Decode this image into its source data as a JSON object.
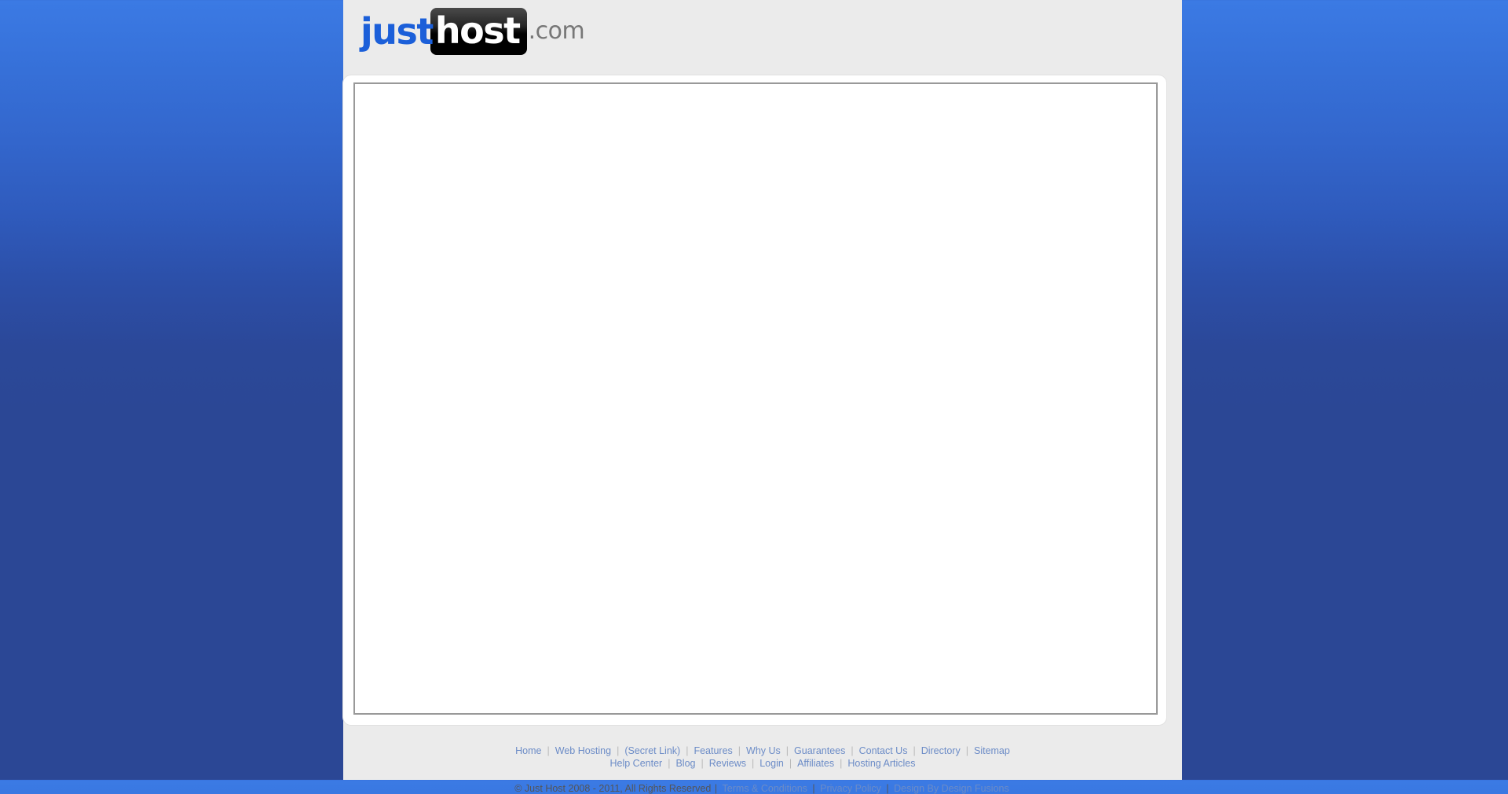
{
  "site": {
    "background_top_color": "#3b7ae4",
    "background_bottom_color": "#2b4795",
    "container_color": "#ebebeb",
    "link_color": "#6c8cc7",
    "panel_border_color": "#999999"
  },
  "header": {
    "logo": {
      "part_just": "just",
      "part_host": "host",
      "part_com": ".com",
      "just_color": "#1b5fd9",
      "host_bg_color": "#000000",
      "com_color": "#777777"
    }
  },
  "main": {
    "content": ""
  },
  "footer": {
    "links_row_1": [
      {
        "label": "Home"
      },
      {
        "label": "Web Hosting"
      },
      {
        "label": "(Secret Link)"
      },
      {
        "label": "Features"
      },
      {
        "label": "Why Us"
      },
      {
        "label": "Guarantees"
      },
      {
        "label": "Contact Us"
      },
      {
        "label": "Directory"
      },
      {
        "label": "Sitemap"
      }
    ],
    "links_row_2": [
      {
        "label": "Help Center"
      },
      {
        "label": "Blog"
      },
      {
        "label": "Reviews"
      },
      {
        "label": "Login"
      },
      {
        "label": "Affiliates"
      },
      {
        "label": "Hosting Articles"
      }
    ],
    "separator": "|",
    "copyright_text": "© Just Host 2008 - 2011, All Rights Reserved",
    "copyright_links": [
      {
        "label": "Terms & Conditions"
      },
      {
        "label": "Privacy Policy"
      },
      {
        "label": "Design By Design Fusions"
      }
    ],
    "copyright_separator": "|"
  }
}
